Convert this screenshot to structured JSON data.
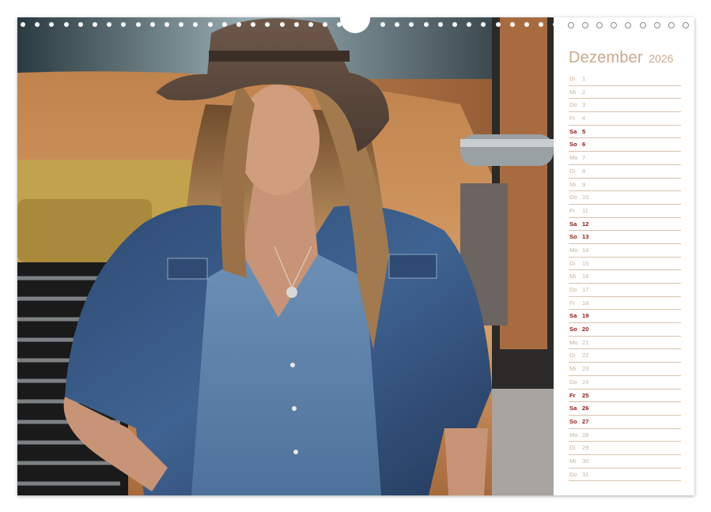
{
  "calendar": {
    "month": "Dezember",
    "year": "2026",
    "days": [
      {
        "name": "Di",
        "num": "1",
        "weekend": false
      },
      {
        "name": "Mi",
        "num": "2",
        "weekend": false
      },
      {
        "name": "Do",
        "num": "3",
        "weekend": false
      },
      {
        "name": "Fr",
        "num": "4",
        "weekend": false
      },
      {
        "name": "Sa",
        "num": "5",
        "weekend": true
      },
      {
        "name": "So",
        "num": "6",
        "weekend": true
      },
      {
        "name": "Mo",
        "num": "7",
        "weekend": false
      },
      {
        "name": "Di",
        "num": "8",
        "weekend": false
      },
      {
        "name": "Mi",
        "num": "9",
        "weekend": false
      },
      {
        "name": "Do",
        "num": "10",
        "weekend": false
      },
      {
        "name": "Fr",
        "num": "11",
        "weekend": false
      },
      {
        "name": "Sa",
        "num": "12",
        "weekend": true
      },
      {
        "name": "So",
        "num": "13",
        "weekend": true
      },
      {
        "name": "Mo",
        "num": "14",
        "weekend": false
      },
      {
        "name": "Di",
        "num": "15",
        "weekend": false
      },
      {
        "name": "Mi",
        "num": "16",
        "weekend": false
      },
      {
        "name": "Do",
        "num": "17",
        "weekend": false
      },
      {
        "name": "Fr",
        "num": "18",
        "weekend": false
      },
      {
        "name": "Sa",
        "num": "19",
        "weekend": true
      },
      {
        "name": "So",
        "num": "20",
        "weekend": true
      },
      {
        "name": "Mo",
        "num": "21",
        "weekend": false
      },
      {
        "name": "Di",
        "num": "22",
        "weekend": false
      },
      {
        "name": "Mi",
        "num": "23",
        "weekend": false
      },
      {
        "name": "Do",
        "num": "24",
        "weekend": false
      },
      {
        "name": "Fr",
        "num": "25",
        "weekend": true
      },
      {
        "name": "Sa",
        "num": "26",
        "weekend": true
      },
      {
        "name": "So",
        "num": "27",
        "weekend": true
      },
      {
        "name": "Mo",
        "num": "28",
        "weekend": false
      },
      {
        "name": "Di",
        "num": "29",
        "weekend": false
      },
      {
        "name": "Mi",
        "num": "30",
        "weekend": false
      },
      {
        "name": "Do",
        "num": "31",
        "weekend": false
      }
    ]
  },
  "colors": {
    "title": "#c9aa8d",
    "weekday_text": "#c8b3a0",
    "weekend_text": "#8e1b14",
    "rule_line": "#d9c2ac"
  },
  "photo": {
    "subject": "woman-in-cowboy-hat-and-denim-shirt-leaning-on-truck"
  }
}
